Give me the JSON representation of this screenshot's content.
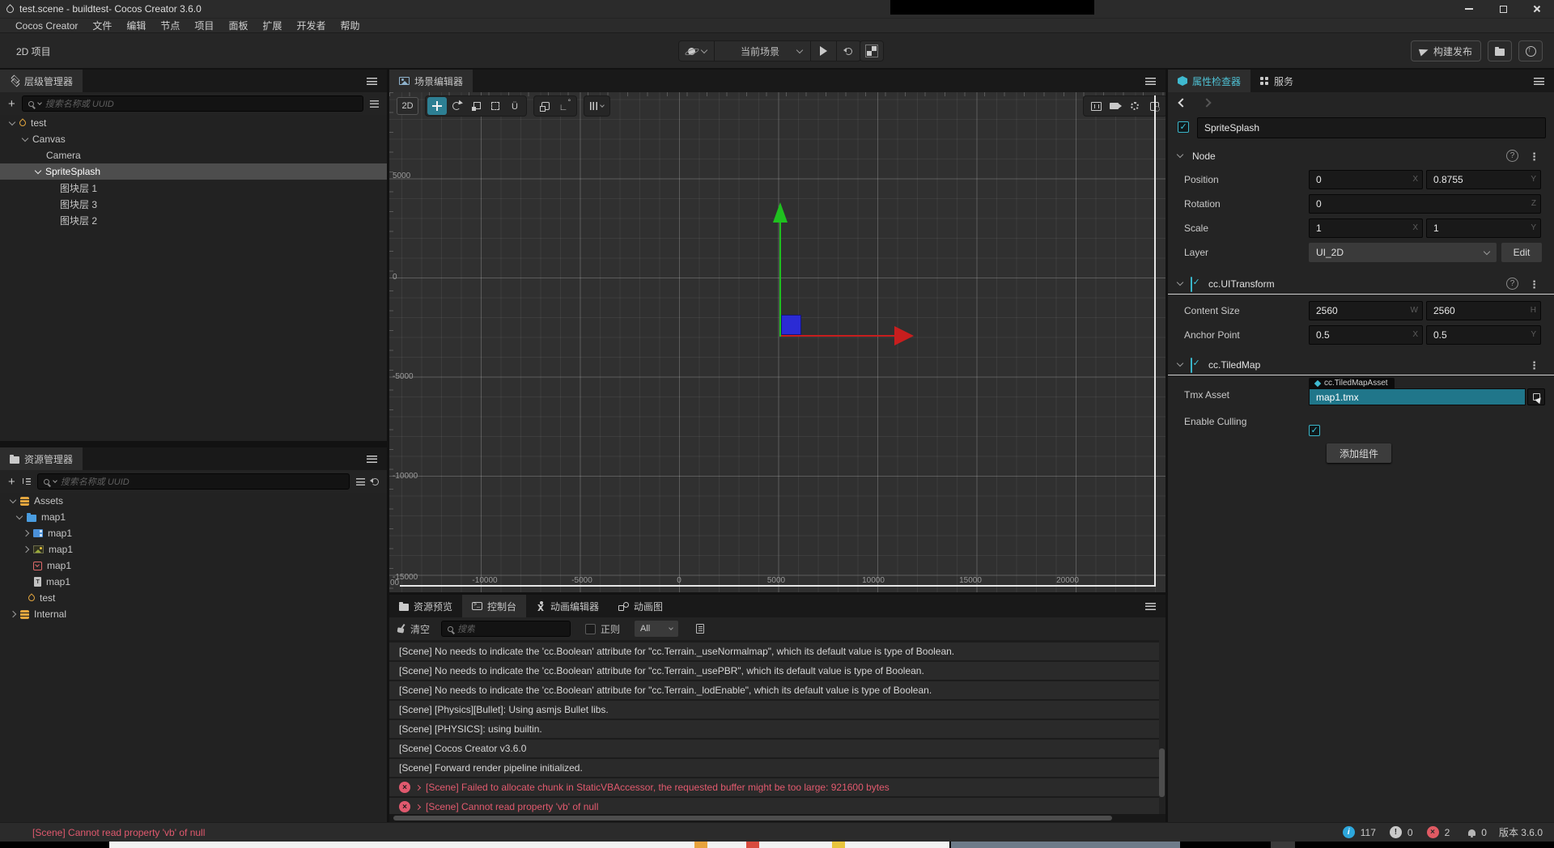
{
  "window": {
    "title": "test.scene - buildtest- Cocos Creator 3.6.0"
  },
  "menu": {
    "items": [
      "Cocos Creator",
      "文件",
      "编辑",
      "节点",
      "项目",
      "面板",
      "扩展",
      "开发者",
      "帮助"
    ]
  },
  "toolbar": {
    "project_label": "2D 项目",
    "scene_dropdown": "当前场景",
    "build_label": "构建发布"
  },
  "hierarchy": {
    "tab": "层级管理器",
    "search_placeholder": "搜索名称或 UUID",
    "items": [
      {
        "label": "test",
        "icon": "scene-file-icon",
        "level": 0,
        "expanded": true
      },
      {
        "label": "Canvas",
        "level": 1,
        "expanded": true
      },
      {
        "label": "Camera",
        "level": 2
      },
      {
        "label": "SpriteSplash",
        "level": 2,
        "expanded": true,
        "selected": true
      },
      {
        "label": "图块层 1",
        "level": 3
      },
      {
        "label": "图块层 3",
        "level": 3
      },
      {
        "label": "图块层 2",
        "level": 3
      }
    ]
  },
  "assets": {
    "tab": "资源管理器",
    "search_placeholder": "搜索名称或 UUID",
    "items": [
      {
        "label": "Assets",
        "icon": "assets-db-icon",
        "level": 0,
        "expanded": true
      },
      {
        "label": "map1",
        "icon": "folder-icon",
        "level": 1,
        "expanded": true
      },
      {
        "label": "map1",
        "icon": "spritesheet-icon",
        "level": 2,
        "collapsed": true
      },
      {
        "label": "map1",
        "icon": "image-file-icon",
        "level": 2,
        "collapsed": true
      },
      {
        "label": "map1",
        "icon": "tilemap-file-icon",
        "level": 2
      },
      {
        "label": "map1",
        "icon": "text-file-icon",
        "level": 2
      },
      {
        "label": "test",
        "icon": "scene-file-icon",
        "level": 1
      },
      {
        "label": "Internal",
        "icon": "assets-db-icon",
        "level": 0,
        "collapsed": true
      }
    ]
  },
  "scene": {
    "tab": "场景编辑器",
    "mode_2d": "2D",
    "ruler_left": [
      "5000",
      "0",
      "-5000",
      "-10000",
      "-15000"
    ],
    "ruler_bottom": [
      "00",
      "-10000",
      "-5000",
      "0",
      "5000",
      "10000",
      "15000",
      "20000"
    ],
    "gizmo_colors": {
      "x_axis": "#c81e1e",
      "y_axis": "#1fc01f",
      "origin": "#2b2bd5"
    },
    "canvas_border_color": "#e8e8e8"
  },
  "console": {
    "tabs": [
      "资源预览",
      "控制台",
      "动画编辑器",
      "动画图"
    ],
    "active_tab": "控制台",
    "clear_label": "清空",
    "search_placeholder": "搜索",
    "regex_label": "正则",
    "filter_value": "All",
    "logs": [
      {
        "type": "log",
        "text": "[Scene] No needs to indicate the 'cc.Boolean' attribute for \"cc.Terrain._useNormalmap\", which its default value is type of Boolean."
      },
      {
        "type": "log",
        "text": "[Scene] No needs to indicate the 'cc.Boolean' attribute for \"cc.Terrain._usePBR\", which its default value is type of Boolean."
      },
      {
        "type": "log",
        "text": "[Scene] No needs to indicate the 'cc.Boolean' attribute for \"cc.Terrain._lodEnable\", which its default value is type of Boolean."
      },
      {
        "type": "log",
        "text": "[Scene] [Physics][Bullet]: Using asmjs Bullet libs."
      },
      {
        "type": "log",
        "text": "[Scene] [PHYSICS]: using builtin."
      },
      {
        "type": "log",
        "text": "[Scene] Cocos Creator v3.6.0"
      },
      {
        "type": "log",
        "text": "[Scene] Forward render pipeline initialized."
      },
      {
        "type": "error",
        "text": "[Scene] Failed to allocate chunk in StaticVBAccessor, the requested buffer might be too large: 921600 bytes"
      },
      {
        "type": "error",
        "text": "[Scene] Cannot read property 'vb' of null"
      }
    ]
  },
  "inspector": {
    "tabs": [
      {
        "label": "属性检查器"
      },
      {
        "label": "服务"
      }
    ],
    "node_name": "SpriteSplash",
    "suffixes": {
      "x": "X",
      "y": "Y",
      "z": "Z",
      "w": "W",
      "h": "H"
    },
    "node": {
      "title": "Node",
      "position_label": "Position",
      "position_x": "0",
      "position_y": "0.8755",
      "rotation_label": "Rotation",
      "rotation_z": "0",
      "scale_label": "Scale",
      "scale_x": "1",
      "scale_y": "1",
      "layer_label": "Layer",
      "layer_value": "UI_2D",
      "edit_label": "Edit"
    },
    "ui_transform": {
      "title": "cc.UITransform",
      "content_size_label": "Content Size",
      "content_w": "2560",
      "content_h": "2560",
      "anchor_label": "Anchor Point",
      "anchor_x": "0.5",
      "anchor_y": "0.5"
    },
    "tiled_map": {
      "title": "cc.TiledMap",
      "tmx_label": "Tmx Asset",
      "tmx_type_tag": "cc.TiledMapAsset",
      "tmx_value": "map1.tmx",
      "culling_label": "Enable Culling"
    },
    "add_component_label": "添加组件"
  },
  "status_bar": {
    "message": "[Scene] Cannot read property 'vb' of null",
    "info_count": "117",
    "warning_count": "0",
    "error_count": "2",
    "notification_count": "0",
    "version_label": "版本 3.6.0"
  }
}
